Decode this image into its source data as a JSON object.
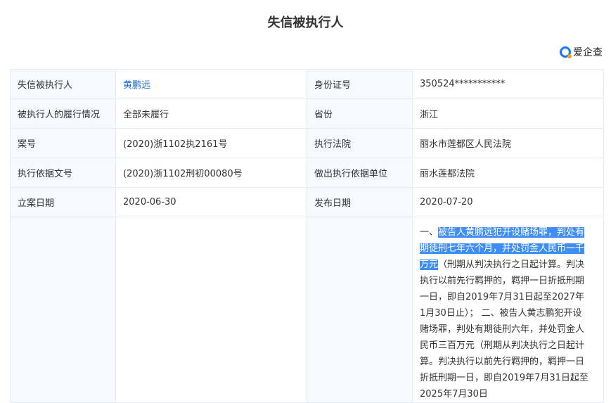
{
  "header": {
    "title": "失信被执行人",
    "logo_text": "爱企查"
  },
  "rows": [
    {
      "l1": "失信被执行人",
      "v1": "黄鹏远",
      "l2": "身份证号",
      "v2": "350524***********"
    },
    {
      "l1": "被执行人的履行情况",
      "v1": "全部未履行",
      "l2": "省份",
      "v2": "浙江"
    },
    {
      "l1": "案号",
      "v1": "(2020)浙1102执2161号",
      "l2": "执行法院",
      "v2": "丽水市莲都区人民法院"
    },
    {
      "l1": "执行依据文号",
      "v1": "(2020)浙1102刑初00080号",
      "l2": "做出执行依据单位",
      "v2": "丽水莲都法院"
    },
    {
      "l1": "立案日期",
      "v1": "2020-06-30",
      "l2": "发布日期",
      "v2": "2020-07-20"
    }
  ],
  "duty": {
    "prefix": "一、",
    "highlighted": "被告人黄鹏远犯开设赌场罪，判处有期徒刑七年六个月，并处罚金人民币一千万元",
    "rest": "（刑期从判决执行之日起计算。判决执行以前先行羁押的，羁押一日折抵刑期一日，即自2019年7月31日起至2027年1月30日止）； 二、被告人黄志鹏犯开设赌场罪，判处有期徒刑六年，并处罚金人民币三百万元（刑期从判决执行之日起计算。判决执行以前先行羁押的，羁押一日折抵刑期一日，即自2019年7月31日起至2025年7月30日"
  }
}
